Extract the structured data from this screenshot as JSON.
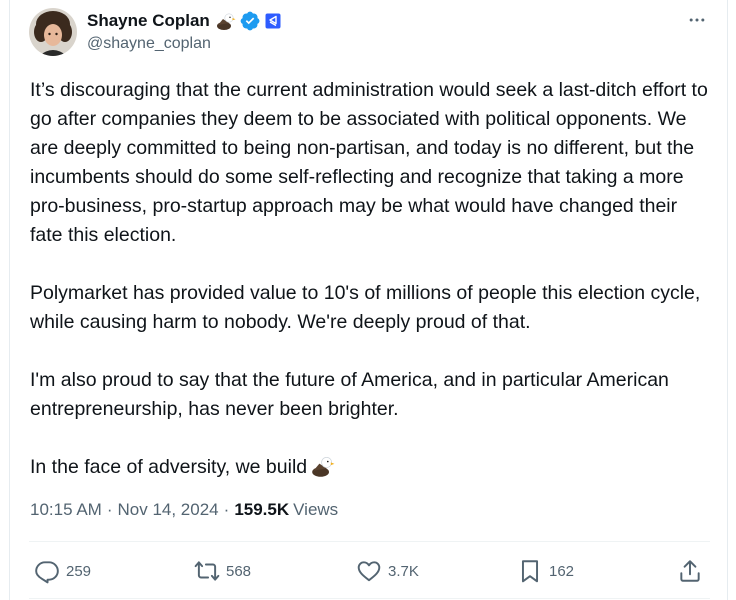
{
  "author": {
    "display_name": "Shayne Coplan",
    "handle": "@shayne_coplan",
    "name_emoji": "eagle-icon",
    "verified": true
  },
  "tweet": {
    "paragraphs": [
      "It’s discouraging that the current administration would seek a last-ditch effort to go after companies they deem to be associated with political opponents. We are deeply committed to being non-partisan, and today is no different, but the incumbents should do some self-reflecting and recognize that taking a more pro-business, pro-startup approach may be what would have changed their fate this election.",
      "Polymarket has provided value to 10's of millions of people this election cycle, while causing harm to nobody. We're deeply proud of that.",
      "I'm also proud to say that the future of America, and in particular American entrepreneurship, has never been brighter.",
      "In the face of adversity, we build"
    ]
  },
  "meta": {
    "time": "10:15 AM",
    "separator": "·",
    "date": "Nov 14, 2024",
    "views_count": "159.5K",
    "views_label": "Views"
  },
  "actions": {
    "replies": "259",
    "reposts": "568",
    "likes": "3.7K",
    "bookmarks": "162"
  },
  "colors": {
    "text": "#0f1419",
    "secondary": "#536471",
    "verified_blue": "#1d9bf0",
    "divider": "#eff3f4"
  }
}
